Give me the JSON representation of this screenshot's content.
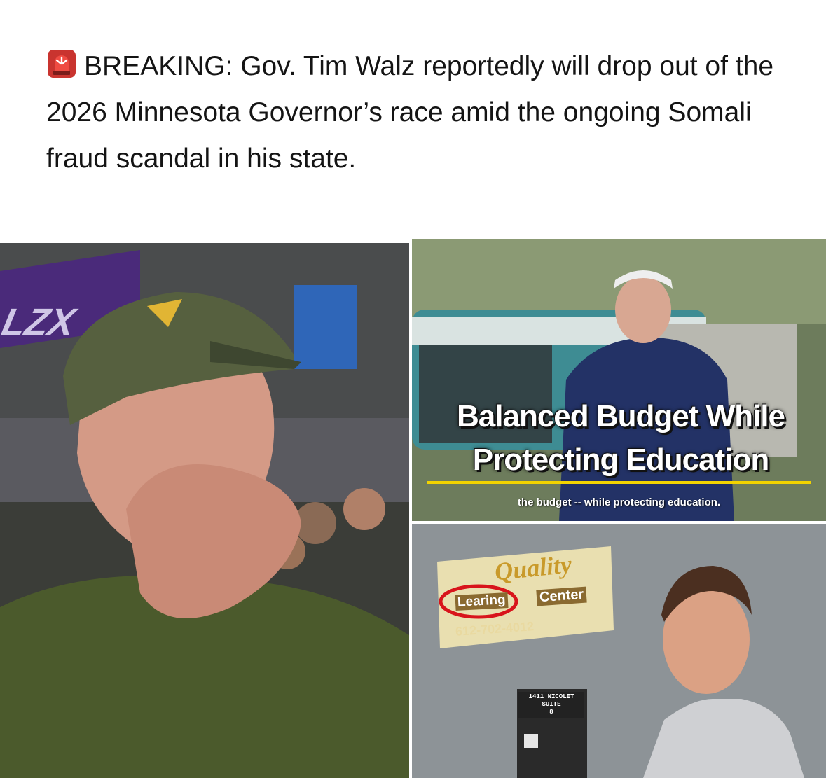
{
  "post": {
    "icon": "police-light-icon",
    "headline": "BREAKING: Gov. Tim Walz reportedly will drop out of the 2026 Minnesota Governor’s race amid the ongoing Somali fraud scandal in his state."
  },
  "images": {
    "top_right": {
      "title_line1": "Balanced Budget While",
      "title_line2": "Protecting Education",
      "caption": "the budget -- while protecting education."
    },
    "bottom_right": {
      "sign_name": "Quality",
      "sign_learing": "Learing",
      "sign_center": "Center",
      "sign_phone": "612-702-4012",
      "address_line1": "1411 NICOLET",
      "address_line2": "SUITE",
      "address_line3": "8"
    },
    "left": {
      "banner_text": "LZX"
    }
  },
  "colors": {
    "accent_yellow": "#f2d300",
    "circle_red": "#d8141b",
    "cap_camo": "#4f5a3a"
  }
}
